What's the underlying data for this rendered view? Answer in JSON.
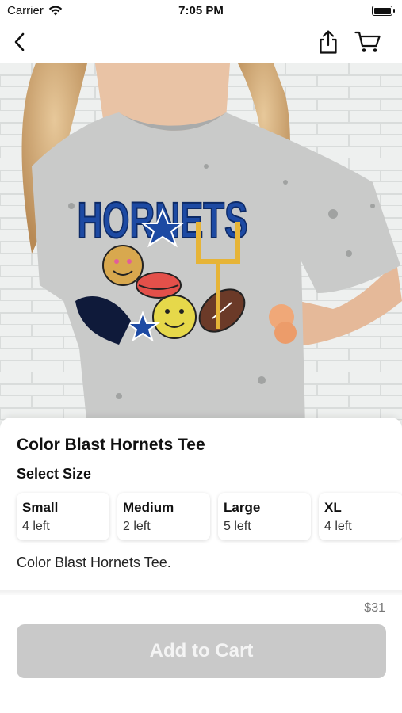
{
  "status_bar": {
    "carrier": "Carrier",
    "time": "7:05 PM"
  },
  "nav": {
    "icons": [
      "chevron-left-icon",
      "share-icon",
      "cart-icon"
    ]
  },
  "hero": {
    "print_text": "HORNETS"
  },
  "product": {
    "title": "Color Blast Hornets Tee",
    "select_size_label": "Select Size",
    "sizes": [
      {
        "name": "Small",
        "stock": "4 left"
      },
      {
        "name": "Medium",
        "stock": "2 left"
      },
      {
        "name": "Large",
        "stock": "5 left"
      },
      {
        "name": "XL",
        "stock": "4 left"
      }
    ],
    "description": "Color Blast Hornets Tee.",
    "price": "$31",
    "add_to_cart_label": "Add to Cart"
  },
  "colors": {
    "button_disabled": "#c9c9c9",
    "shirt_print_blue": "#1d4aa3",
    "accent_gold": "#e6b437"
  }
}
